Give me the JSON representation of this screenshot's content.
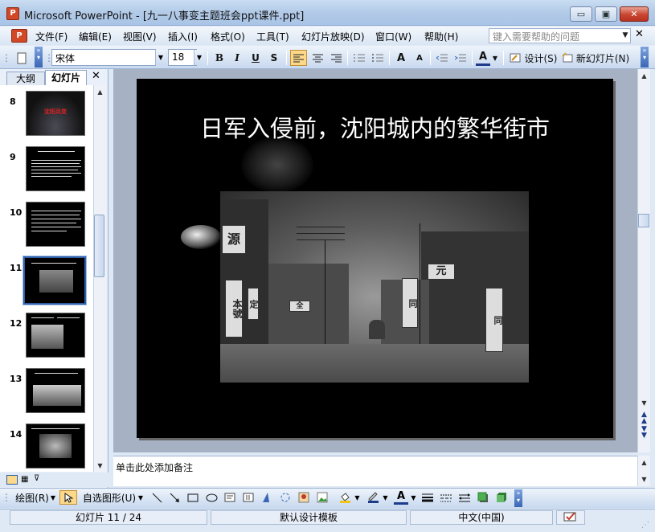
{
  "window": {
    "app_icon": "P",
    "title": "Microsoft PowerPoint - [九一八事变主题班会ppt课件.ppt]",
    "minimize": "▭",
    "restore": "▣",
    "close": "✕"
  },
  "menu": {
    "items": [
      "文件(F)",
      "编辑(E)",
      "视图(V)",
      "插入(I)",
      "格式(O)",
      "工具(T)",
      "幻灯片放映(D)",
      "窗口(W)",
      "帮助(H)"
    ],
    "help_placeholder": "键入需要帮助的问题",
    "close_label": "✕"
  },
  "toolbar": {
    "font_name": "宋体",
    "font_size": "18",
    "bold": "B",
    "italic": "I",
    "underline": "U",
    "shadow": "S",
    "increase_font": "A",
    "decrease_font": "A",
    "font_color": "A",
    "design_label": "设计(S)",
    "new_slide_label": "新幻灯片(N)"
  },
  "left_panel": {
    "tab_outline": "大纲",
    "tab_slides": "幻灯片",
    "close": "✕",
    "slide_numbers": [
      "8",
      "9",
      "10",
      "11",
      "12",
      "13",
      "14"
    ],
    "slide8_title": "沈阳兵变"
  },
  "slide": {
    "title": "日军入侵前，沈阳城内的繁华街市",
    "photo_signs": [
      "源",
      "本號",
      "定",
      "元",
      "同",
      "全",
      "同"
    ]
  },
  "notes": {
    "placeholder": "单击此处添加备注"
  },
  "drawing_toolbar": {
    "draw_label": "绘图(R)",
    "autoshapes_label": "自选图形(U)"
  },
  "status": {
    "slide_info": "幻灯片 11 / 24",
    "template": "默认设计模板",
    "language": "中文(中国)"
  },
  "colors": {
    "accent": "#2e5fa8",
    "slide_bg": "#000000",
    "title_text": "#ffffff"
  }
}
